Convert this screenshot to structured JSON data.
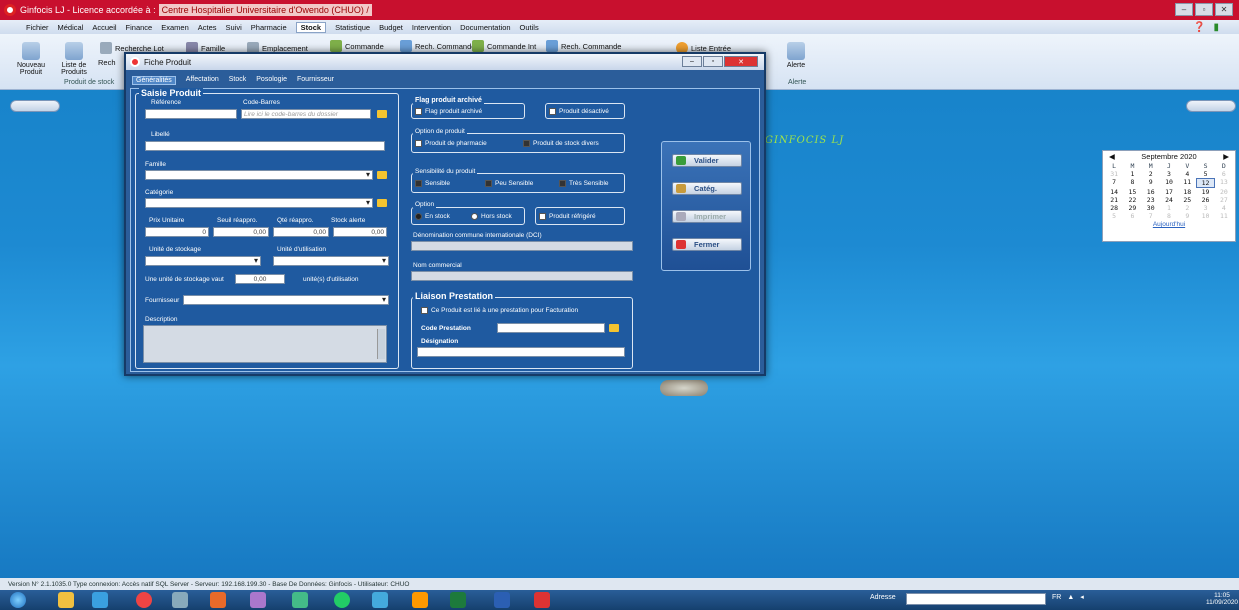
{
  "window": {
    "title": "Ginfocis LJ  -  Licence accordée à :",
    "licensee": "Centre Hospitalier Universitaire d'Owendo (CHUO) /"
  },
  "menu": [
    "Fichier",
    "Médical",
    "Accueil",
    "Finance",
    "Examen",
    "Actes",
    "Suivi",
    "Pharmacie",
    "Stock",
    "Statistique",
    "Budget",
    "Intervention",
    "Documentation",
    "Outils"
  ],
  "menu_selected": "Stock",
  "ribbon": {
    "nouveau_produit": "Nouveau Produit",
    "liste_produits": "Liste de Produits",
    "recherche_lot": "Recherche Lot",
    "famille": "Famille",
    "emplacement": "Emplacement",
    "commande": "Commande",
    "rech_commande": "Rech. Commande",
    "commande_int": "Commande Int",
    "rech_commande2": "Rech. Commande",
    "liste_entree": "Liste Entrée",
    "alerte": "Alerte",
    "group_produit": "Produit de stock",
    "group_alerte": "Alerte",
    "rech_partial": "Rech"
  },
  "dialog": {
    "title": "Fiche Produit",
    "tabs": [
      "Généralités",
      "Affectation",
      "Stock",
      "Posologie",
      "Fournisseur"
    ],
    "active_tab": "Généralités",
    "saisie": {
      "title": "Saisie Produit",
      "reference": "Référence",
      "code_barres": "Code-Barres",
      "code_barres_ph": "Lire ici le code-barres du dossier",
      "libelle": "Libellé",
      "famille": "Famille",
      "categorie": "Catégorie",
      "prix_unitaire": "Prix Unitaire",
      "seuil": "Seuil réappro.",
      "qte": "Qté réappro.",
      "stock_alerte": "Stock alerte",
      "prix_val": "0",
      "seuil_val": "0,00",
      "qte_val": "0,00",
      "alerte_val": "0,00",
      "unite_stockage": "Unité de stockage",
      "unite_utilisation": "Unité d'utilisation",
      "une_unite": "Une unité de stockage vaut",
      "une_unite_val": "0,00",
      "unites_util": "unité(s) d'utilisation",
      "fournisseur": "Fournisseur",
      "description": "Description"
    },
    "flag": {
      "title": "Flag produit archivé",
      "flag_label": "Flag produit archivé",
      "desactive": "Produit désactivé"
    },
    "option_produit": {
      "title": "Option de produit",
      "pharmacie": "Produit de pharmacie",
      "divers": "Produit de stock divers"
    },
    "sensibilite": {
      "title": "Sensibilité du produit",
      "sensible": "Sensible",
      "peu": "Peu Sensible",
      "tres": "Très Sensible"
    },
    "option": {
      "title": "Option",
      "en_stock": "En stock",
      "hors_stock": "Hors stock",
      "refrigere": "Produit réfrigéré"
    },
    "dci": "Dénomination commune internationale (DCI)",
    "nom_commercial": "Nom commercial",
    "liaison": {
      "title": "Liaison Prestation",
      "check": "Ce Produit est lié à une prestation pour Facturation",
      "code": "Code Prestation",
      "designation": "Désignation"
    },
    "actions": {
      "valider": "Valider",
      "categ": "Catég.",
      "imprimer": "Imprimer",
      "fermer": "Fermer"
    }
  },
  "brand": "GINFOCIS LJ",
  "calendar": {
    "month": "Septembre 2020",
    "dow": [
      "L",
      "M",
      "M",
      "J",
      "V",
      "S",
      "D"
    ],
    "days": [
      [
        "31",
        true
      ],
      [
        "1",
        false
      ],
      [
        "2",
        false
      ],
      [
        "3",
        false
      ],
      [
        "4",
        false
      ],
      [
        "5",
        false
      ],
      [
        "6",
        true
      ],
      [
        "7",
        false
      ],
      [
        "8",
        false
      ],
      [
        "9",
        false
      ],
      [
        "10",
        false
      ],
      [
        "11",
        false
      ],
      [
        "12",
        false
      ],
      [
        "13",
        true
      ],
      [
        "14",
        false
      ],
      [
        "15",
        false
      ],
      [
        "16",
        false
      ],
      [
        "17",
        false
      ],
      [
        "18",
        false
      ],
      [
        "19",
        false
      ],
      [
        "20",
        true
      ],
      [
        "21",
        false
      ],
      [
        "22",
        false
      ],
      [
        "23",
        false
      ],
      [
        "24",
        false
      ],
      [
        "25",
        false
      ],
      [
        "26",
        false
      ],
      [
        "27",
        true
      ],
      [
        "28",
        false
      ],
      [
        "29",
        false
      ],
      [
        "30",
        false
      ],
      [
        "1",
        true
      ],
      [
        "2",
        true
      ],
      [
        "3",
        true
      ],
      [
        "4",
        true
      ],
      [
        "5",
        true
      ],
      [
        "6",
        true
      ],
      [
        "7",
        true
      ],
      [
        "8",
        true
      ],
      [
        "9",
        true
      ],
      [
        "10",
        true
      ],
      [
        "11",
        true
      ]
    ],
    "today_index": 12,
    "today_label": "Aujourd'hui"
  },
  "status": "Version N° 2.1.1035.0    Type connexion: Accès natif SQL Server  -  Serveur: 192.168.199.30  -  Base De Données: Ginfocis  -  Utilisateur: CHUO",
  "taskbar": {
    "adresse": "Adresse",
    "lang": "FR",
    "time": "11:05",
    "date": "11/09/2020"
  }
}
